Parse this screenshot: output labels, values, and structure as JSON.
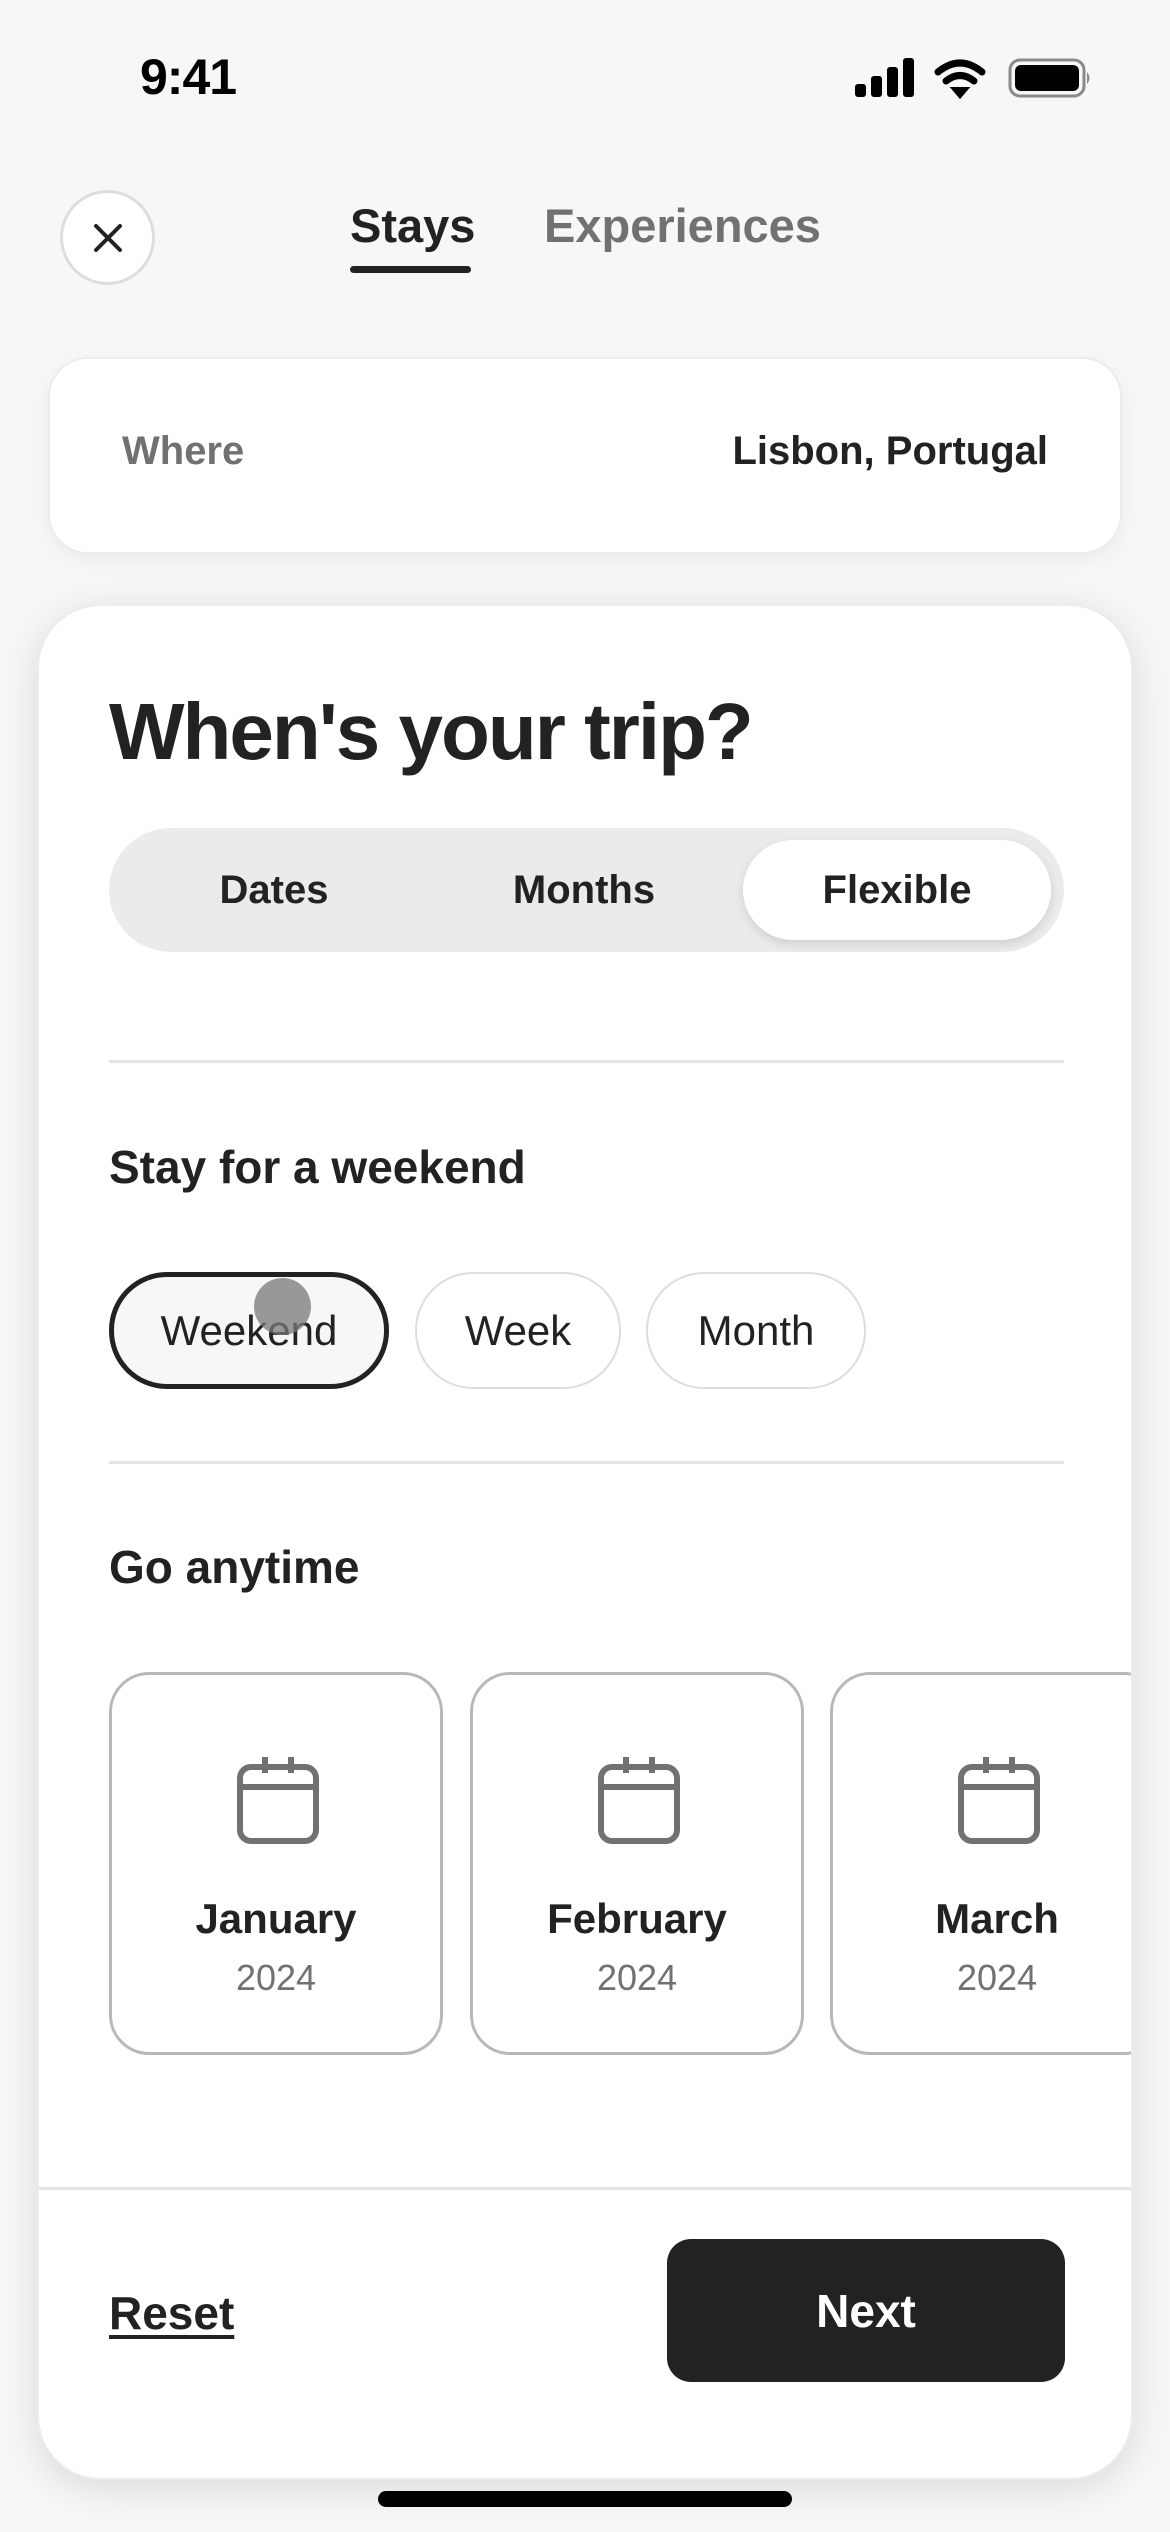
{
  "status_bar": {
    "time": "9:41",
    "icons": [
      "cellular-signal-icon",
      "wifi-icon",
      "battery-icon"
    ]
  },
  "header": {
    "close_icon": "close-icon",
    "tabs": [
      {
        "label": "Stays",
        "active": true
      },
      {
        "label": "Experiences",
        "active": false
      }
    ]
  },
  "where": {
    "label": "Where",
    "value": "Lisbon, Portugal"
  },
  "trip": {
    "heading": "When's your trip?",
    "segments": [
      {
        "label": "Dates",
        "selected": false
      },
      {
        "label": "Months",
        "selected": false
      },
      {
        "label": "Flexible",
        "selected": true
      }
    ],
    "stay_section": {
      "title": "Stay for a weekend",
      "options": [
        {
          "label": "Weekend",
          "selected": true
        },
        {
          "label": "Week",
          "selected": false
        },
        {
          "label": "Month",
          "selected": false
        }
      ]
    },
    "go_section": {
      "title": "Go anytime",
      "months": [
        {
          "name": "January",
          "year": "2024",
          "icon": "calendar-icon"
        },
        {
          "name": "February",
          "year": "2024",
          "icon": "calendar-icon"
        },
        {
          "name": "March",
          "year": "2024",
          "icon": "calendar-icon"
        }
      ]
    }
  },
  "footer": {
    "reset_label": "Reset",
    "next_label": "Next"
  },
  "colors": {
    "primary_text": "#222222",
    "secondary_text": "#717171",
    "background": "#f7f7f8",
    "button_dark": "#222222"
  }
}
